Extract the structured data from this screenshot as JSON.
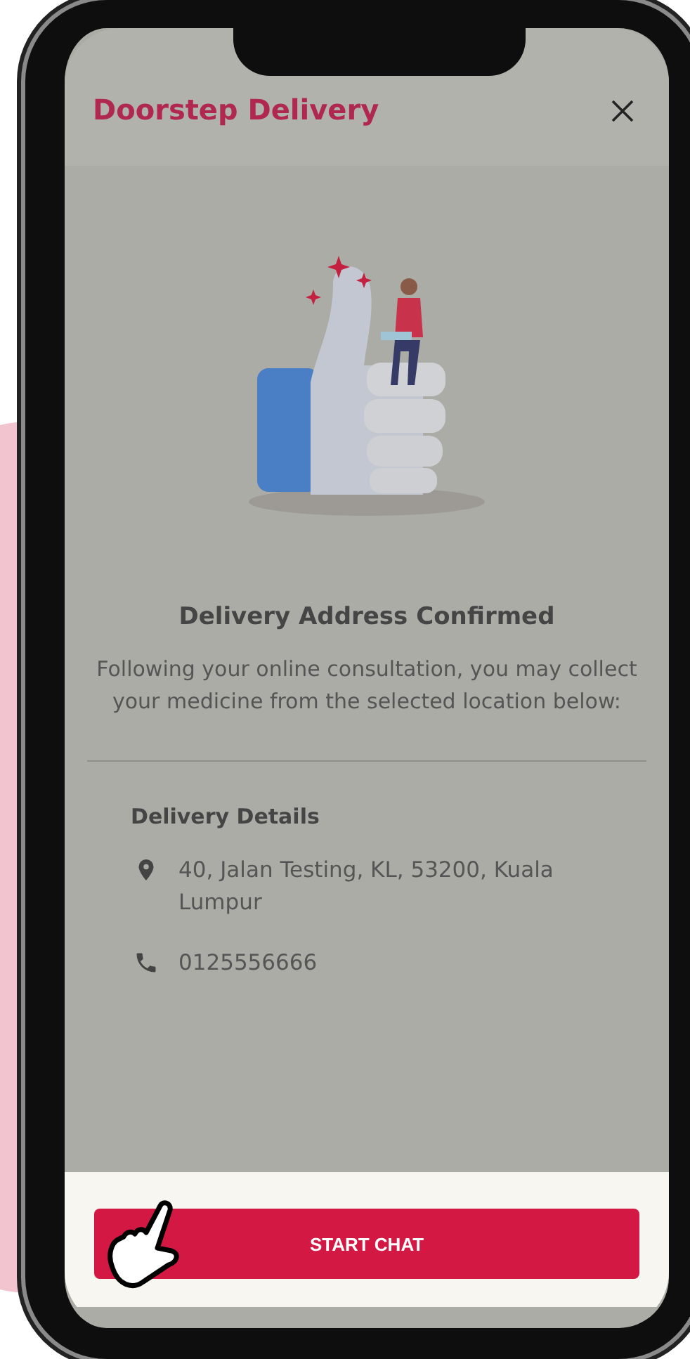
{
  "header": {
    "title": "Doorstep Delivery"
  },
  "message": {
    "title": "Delivery Address Confirmed",
    "body": "Following your online consultation, you may collect your medicine from the selected location below:"
  },
  "details": {
    "title": "Delivery Details",
    "items": [
      {
        "kind": "address",
        "text": "40, Jalan Testing, KL, 53200, Kuala Lumpur"
      },
      {
        "kind": "phone",
        "text": "0125556666"
      }
    ]
  },
  "action": {
    "label": "START CHAT"
  }
}
